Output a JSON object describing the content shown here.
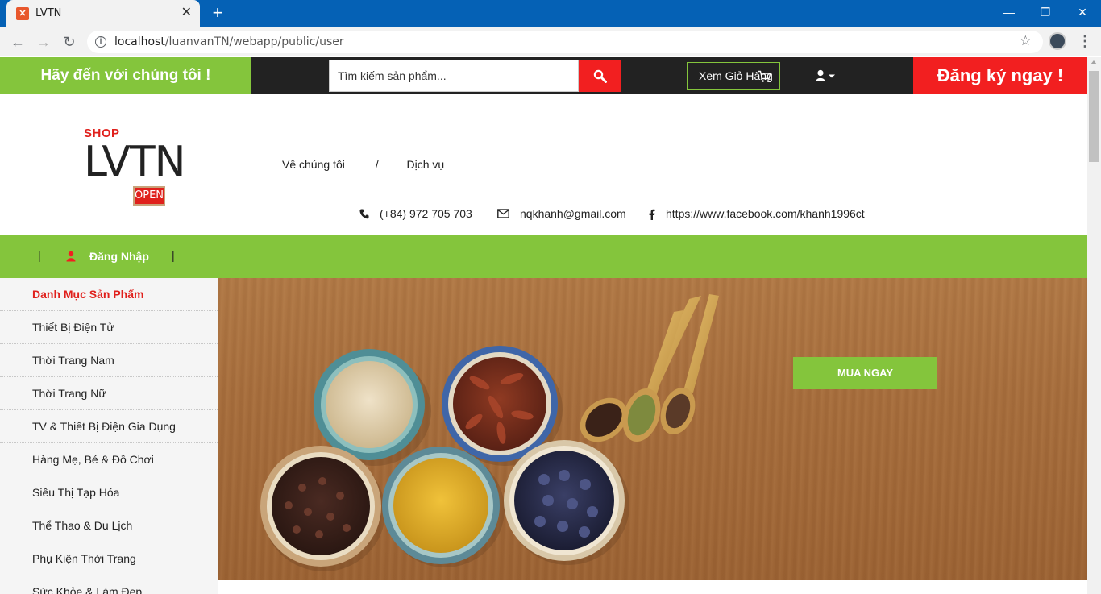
{
  "browser": {
    "tab_title": "LVTN",
    "url_host": "localhost",
    "url_path": "/luanvanTN/webapp/public/user",
    "new_tab": "+",
    "win_min": "—",
    "win_restore": "❐",
    "win_close": "✕"
  },
  "topbar": {
    "welcome": "Hãy đến với chúng tôi !",
    "search_placeholder": "Tìm kiếm sản phẩm...",
    "cart_label": "Xem Giỏ Hàng",
    "register": "Đăng ký ngay !"
  },
  "logo": {
    "shop": "SHOP",
    "name": "LVTN",
    "sign": "OPEN"
  },
  "topnav": {
    "about": "Về chúng tôi",
    "separator": "/",
    "services": "Dịch vụ"
  },
  "contact": {
    "phone": "(+84) 972 705 703",
    "email": "nqkhanh@gmail.com",
    "facebook": "https://www.facebook.com/khanh1996ct"
  },
  "mainnav": {
    "separator": "|",
    "login": "Đăng Nhập"
  },
  "categories": {
    "title": "Danh Mục Sản Phẩm",
    "items": [
      "Thiết Bị Điện Tử",
      "Thời Trang Nam",
      "Thời Trang Nữ",
      "TV & Thiết Bị Điện Gia Dụng",
      "Hàng Mẹ, Bé & Đồ Chơi",
      "Siêu Thị Tạp Hóa",
      "Thể Thao & Du Lịch",
      "Phụ Kiện Thời Trang",
      "Sức Khỏe & Làm Đẹp"
    ]
  },
  "banner": {
    "buy_now": "MUA NGAY"
  },
  "colors": {
    "green": "#84c53c",
    "red": "#f21f20",
    "dark": "#222222",
    "chrome_blue": "#0561b5"
  }
}
